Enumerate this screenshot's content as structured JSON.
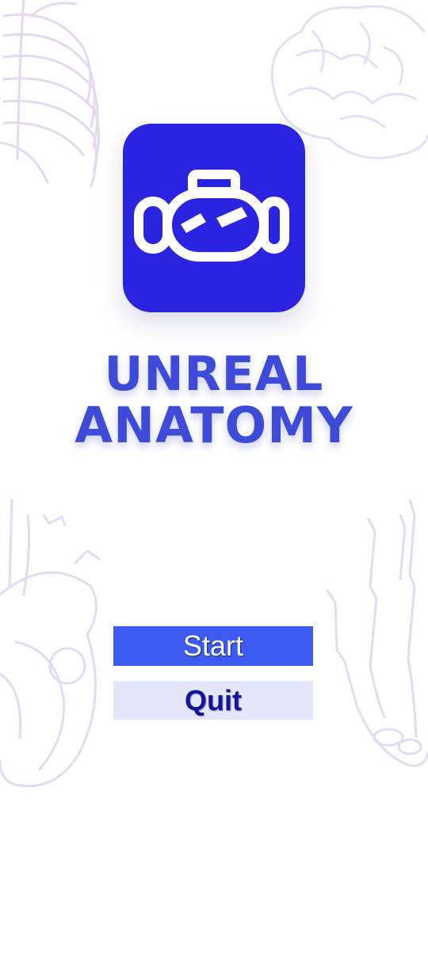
{
  "app": {
    "title_line1": "UNREAL",
    "title_line2": "ANATOMY"
  },
  "menu": {
    "start_label": "Start",
    "quit_label": "Quit"
  },
  "background": {
    "illustrations": [
      "ribcage-illustration",
      "brain-illustration",
      "heart-illustration",
      "hand-skeleton-illustration"
    ]
  },
  "colors": {
    "icon_background": "#2a24e0",
    "title": "#3e4ad8",
    "start_button": "#3d5af1",
    "quit_button": "#e3e7f9",
    "quit_text": "#13139e"
  }
}
